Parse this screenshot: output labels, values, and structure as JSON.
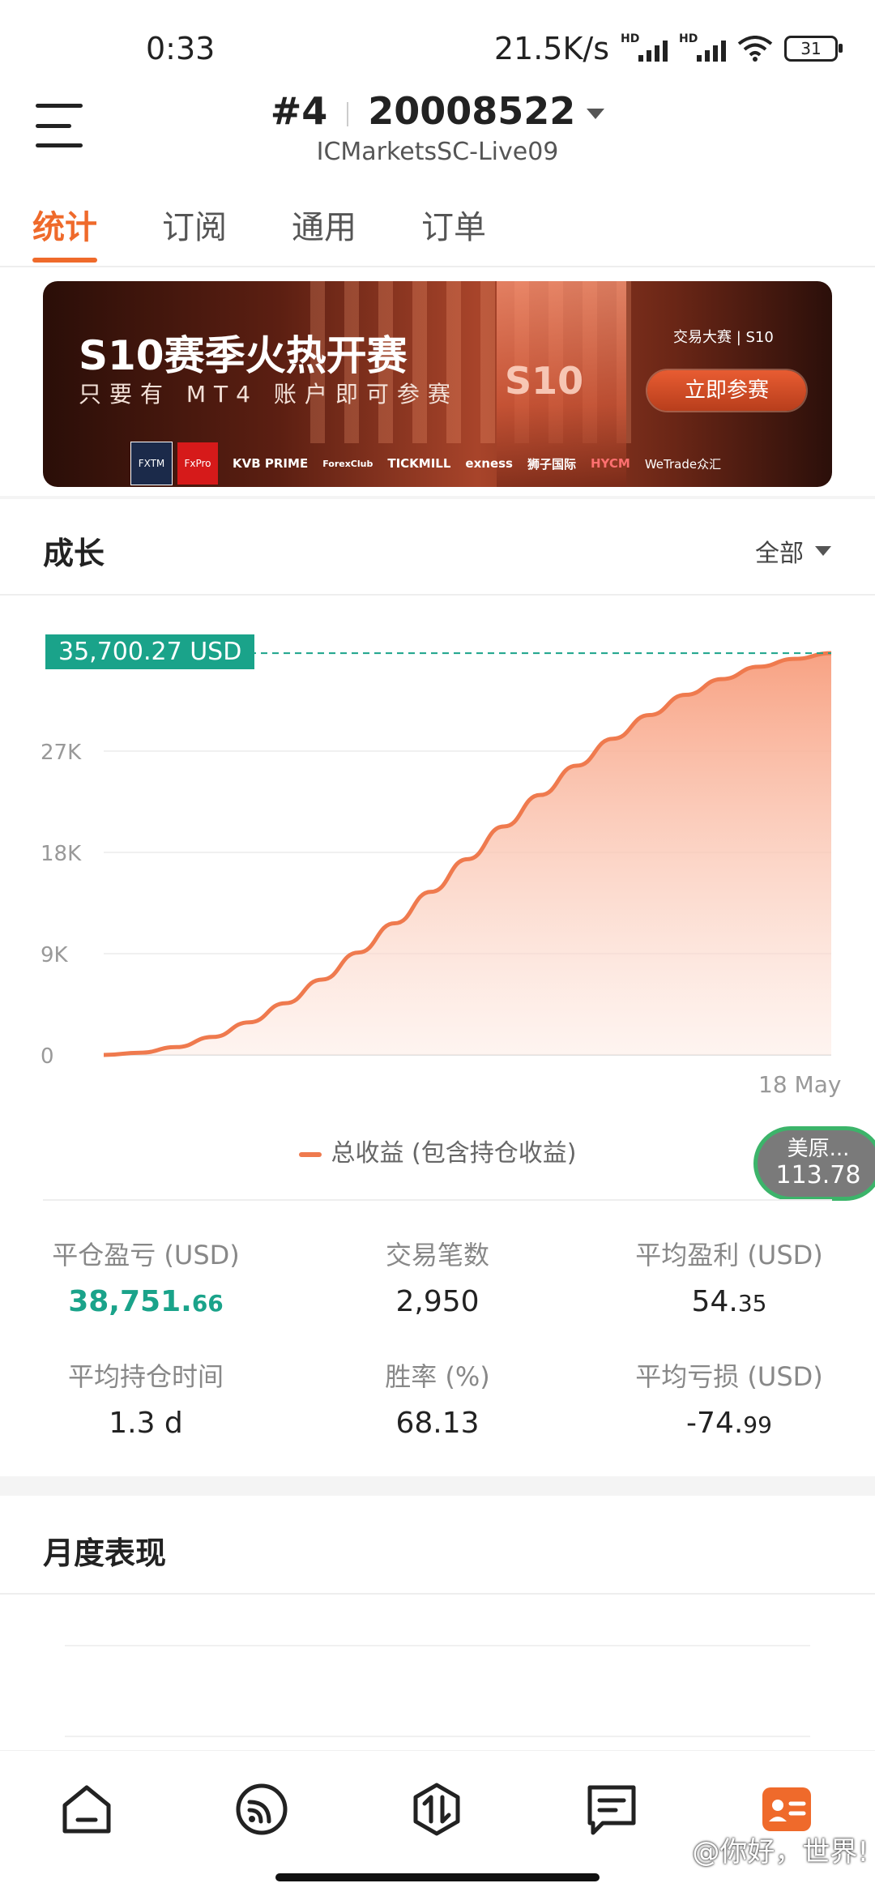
{
  "status_bar": {
    "time": "0:33",
    "network_speed": "21.5K/s",
    "hd1": "HD",
    "hd2": "HD",
    "battery": "31"
  },
  "header": {
    "account_index": "#4",
    "account_number": "20008522",
    "server": "ICMarketsSC-Live09"
  },
  "tabs": [
    "统计",
    "订阅",
    "通用",
    "订单"
  ],
  "active_tab": "统计",
  "banner": {
    "title": "S10赛季火热开赛",
    "subtitle": "只要有 MT4 账户即可参赛",
    "season_mark": "S10",
    "brand": "交易大赛 | S10",
    "cta": "立即参赛",
    "sponsors": [
      "FXTM",
      "FxPro",
      "KVB PRIME",
      "ForexClub",
      "TICKMILL",
      "exness",
      "狮子国际",
      "HYCM",
      "WeTrade众汇"
    ]
  },
  "growth": {
    "title": "成长",
    "filter": "全部",
    "max_label": "35,700.27 USD",
    "legend": "总收益 (包含持仓收益)"
  },
  "chart_data": {
    "type": "area",
    "series": [
      {
        "name": "总收益 (包含持仓收益)",
        "x": [
          0,
          1,
          2,
          3,
          4,
          5,
          6,
          7,
          8,
          9,
          10,
          11,
          12,
          13,
          14,
          15,
          16,
          17,
          18,
          19,
          20
        ],
        "values": [
          0,
          200,
          700,
          1600,
          2900,
          4600,
          6700,
          9100,
          11700,
          14500,
          17400,
          20300,
          23100,
          25700,
          28100,
          30200,
          32000,
          33400,
          34500,
          35200,
          35700.27
        ]
      }
    ],
    "yticks": [
      "0",
      "9K",
      "18K",
      "27K"
    ],
    "ylim": [
      0,
      36000
    ],
    "xtick": "18 May",
    "grid": true,
    "colors": {
      "line": "#ef7a4e",
      "fill_top": "#f8a283",
      "max_line": "#1aa38a"
    }
  },
  "floating_ticker": {
    "name": "美原...",
    "value": "113.78"
  },
  "stats": {
    "closed_pnl_label": "平仓盈亏 (USD)",
    "closed_pnl_int": "38,751.",
    "closed_pnl_dec": "66",
    "trade_count_label": "交易笔数",
    "trade_count": "2,950",
    "avg_profit_label": "平均盈利 (USD)",
    "avg_profit_int": "54.",
    "avg_profit_dec": "35",
    "avg_hold_label": "平均持仓时间",
    "avg_hold": "1.3 d",
    "win_rate_label": "胜率 (%)",
    "win_rate": "68.13",
    "avg_loss_label": "平均亏损 (USD)",
    "avg_loss_int": "-74.",
    "avg_loss_dec": "99"
  },
  "monthly": {
    "title": "月度表现"
  },
  "bottom_nav": [
    "home-icon",
    "signal-icon",
    "trade-icon",
    "message-icon",
    "profile-icon"
  ],
  "watermark": "@你好，世界!"
}
